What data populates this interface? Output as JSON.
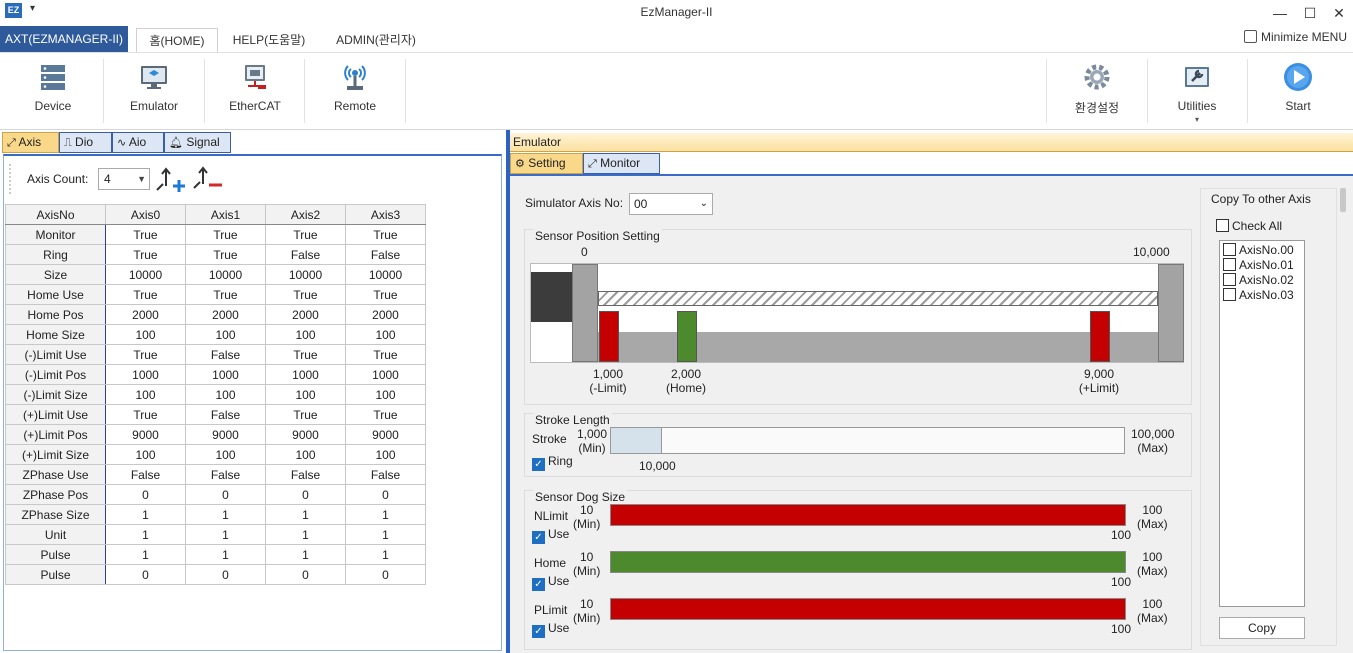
{
  "titlebar": {
    "app_icon": "EZ",
    "quick_access": "▾",
    "title": "EzManager-II",
    "minimize": "—",
    "maximize": "☐",
    "close": "✕"
  },
  "ribbon": {
    "app_menu": "AXT(EZMANAGER-II)",
    "tabs": [
      "홈(HOME)",
      "HELP(도움말)",
      "ADMIN(관리자)"
    ],
    "minimize_menu": "Minimize MENU",
    "buttons": {
      "device": "Device",
      "emulator": "Emulator",
      "ethercat": "EtherCAT",
      "remote": "Remote",
      "settings": "환경설정",
      "utilities": "Utilities",
      "start": "Start"
    },
    "utilities_dropdown": "▾"
  },
  "left": {
    "tabs": [
      "Axis",
      "Dio",
      "Aio",
      "Signal"
    ],
    "axis_count_label": "Axis Count:",
    "axis_count_value": "4",
    "table": {
      "headers": [
        "AxisNo",
        "Axis0",
        "Axis1",
        "Axis2",
        "Axis3"
      ],
      "rows": [
        [
          "Monitor",
          "True",
          "True",
          "True",
          "True"
        ],
        [
          "Ring",
          "True",
          "True",
          "False",
          "False"
        ],
        [
          "Size",
          "10000",
          "10000",
          "10000",
          "10000"
        ],
        [
          "Home Use",
          "True",
          "True",
          "True",
          "True"
        ],
        [
          "Home Pos",
          "2000",
          "2000",
          "2000",
          "2000"
        ],
        [
          "Home Size",
          "100",
          "100",
          "100",
          "100"
        ],
        [
          "(-)Limit Use",
          "True",
          "False",
          "True",
          "True"
        ],
        [
          "(-)Limit Pos",
          "1000",
          "1000",
          "1000",
          "1000"
        ],
        [
          "(-)Limit Size",
          "100",
          "100",
          "100",
          "100"
        ],
        [
          "(+)Limit Use",
          "True",
          "False",
          "True",
          "True"
        ],
        [
          "(+)Limit Pos",
          "9000",
          "9000",
          "9000",
          "9000"
        ],
        [
          "(+)Limit Size",
          "100",
          "100",
          "100",
          "100"
        ],
        [
          "ZPhase Use",
          "False",
          "False",
          "False",
          "False"
        ],
        [
          "ZPhase Pos",
          "0",
          "0",
          "0",
          "0"
        ],
        [
          "ZPhase Size",
          "1",
          "1",
          "1",
          "1"
        ],
        [
          "Unit",
          "1",
          "1",
          "1",
          "1"
        ],
        [
          "Pulse",
          "1",
          "1",
          "1",
          "1"
        ],
        [
          "Pulse",
          "0",
          "0",
          "0",
          "0"
        ]
      ]
    }
  },
  "emulator": {
    "header": "Emulator",
    "tabs": [
      "Setting",
      "Monitor"
    ],
    "sim_axis_label": "Simulator Axis No:",
    "sim_axis_value": "00",
    "sensor_position": {
      "title": "Sensor Position Setting",
      "min_label": "0",
      "max_label": "10,000",
      "limit_minus": {
        "value": "1,000",
        "name": "(-Limit)",
        "pos": 1000
      },
      "home": {
        "value": "2,000",
        "name": "(Home)",
        "pos": 2000
      },
      "limit_plus": {
        "value": "9,000",
        "name": "(+Limit)",
        "pos": 9000
      },
      "range": 10000
    },
    "stroke": {
      "title": "Stroke Length",
      "label": "Stroke",
      "min_value": "1,000",
      "min_tag": "(Min)",
      "max_value": "100,000",
      "max_tag": "(Max)",
      "current": "10,000",
      "ring_label": "Ring",
      "fill_fraction": 0.1
    },
    "dog": {
      "title": "Sensor Dog Size",
      "items": [
        {
          "name": "NLimit",
          "min": "10",
          "min_tag": "(Min)",
          "max": "100",
          "max_tag": "(Max)",
          "value": "100",
          "use": "Use",
          "color": "#c40000"
        },
        {
          "name": "Home",
          "min": "10",
          "min_tag": "(Min)",
          "max": "100",
          "max_tag": "(Max)",
          "value": "100",
          "use": "Use",
          "color": "#4d8a2e"
        },
        {
          "name": "PLimit",
          "min": "10",
          "min_tag": "(Min)",
          "max": "100",
          "max_tag": "(Max)",
          "value": "100",
          "use": "Use",
          "color": "#c40000"
        }
      ]
    },
    "copy": {
      "title": "Copy To other Axis",
      "check_all": "Check All",
      "axes": [
        "AxisNo.00",
        "AxisNo.01",
        "AxisNo.02",
        "AxisNo.03"
      ],
      "button": "Copy"
    }
  }
}
